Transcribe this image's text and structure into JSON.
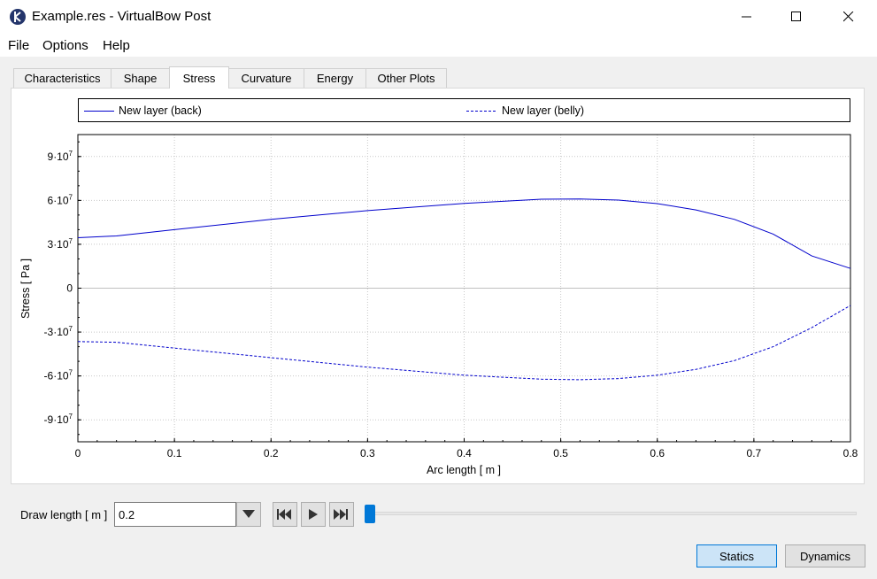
{
  "window": {
    "title": "Example.res - VirtualBow Post"
  },
  "menu": {
    "items": [
      "File",
      "Options",
      "Help"
    ]
  },
  "tabs": [
    "Characteristics",
    "Shape",
    "Stress",
    "Curvature",
    "Energy",
    "Other Plots"
  ],
  "active_tab": "Stress",
  "legend": {
    "back": "New layer (back)",
    "belly": "New layer (belly)"
  },
  "controls": {
    "draw_length_label": "Draw length [ m ]",
    "draw_length_value": "0.2",
    "slider_value": 0
  },
  "buttons": {
    "statics": "Statics",
    "dynamics": "Dynamics"
  },
  "colors": {
    "series": "#0000cc",
    "accent": "#0078d7"
  },
  "icons": [
    "virtualbow-logo-icon",
    "minimize-icon",
    "maximize-icon",
    "close-icon",
    "dropdown-arrow-icon",
    "skip-start-icon",
    "play-icon",
    "skip-end-icon"
  ],
  "chart_data": {
    "type": "line",
    "xlabel": "Arc length [ m ]",
    "ylabel": "Stress [ Pa ]",
    "xlim": [
      0,
      0.8
    ],
    "ylim": [
      -105000000,
      105000000
    ],
    "x_ticks": [
      "0",
      "0.1",
      "0.2",
      "0.3",
      "0.4",
      "0.5",
      "0.6",
      "0.7",
      "0.8"
    ],
    "y_ticks": [
      {
        "base": "9·10",
        "exp": "7"
      },
      {
        "base": "6·10",
        "exp": "7"
      },
      {
        "base": "3·10",
        "exp": "7"
      },
      {
        "base": "0",
        "exp": ""
      },
      {
        "base": "-3·10",
        "exp": "7"
      },
      {
        "base": "-6·10",
        "exp": "7"
      },
      {
        "base": "-9·10",
        "exp": "7"
      }
    ],
    "grid": true,
    "legend": "top",
    "series": [
      {
        "name": "New layer (back)",
        "style": "solid",
        "x": [
          0,
          0.04,
          0.1,
          0.2,
          0.3,
          0.4,
          0.48,
          0.52,
          0.56,
          0.6,
          0.64,
          0.68,
          0.72,
          0.76,
          0.8
        ],
        "y": [
          34500000,
          35700000,
          40000000,
          47000000,
          53000000,
          58000000,
          60800000,
          61000000,
          60200000,
          57800000,
          53500000,
          47000000,
          37000000,
          22000000,
          13500000
        ]
      },
      {
        "name": "New layer (belly)",
        "style": "dashed",
        "x": [
          0,
          0.04,
          0.1,
          0.2,
          0.3,
          0.4,
          0.48,
          0.52,
          0.56,
          0.6,
          0.64,
          0.68,
          0.72,
          0.76,
          0.8
        ],
        "y": [
          -36500000,
          -37000000,
          -41000000,
          -47500000,
          -54000000,
          -59500000,
          -62200000,
          -62600000,
          -61800000,
          -59500000,
          -55500000,
          -49500000,
          -40000000,
          -27000000,
          -11800000
        ]
      }
    ]
  }
}
